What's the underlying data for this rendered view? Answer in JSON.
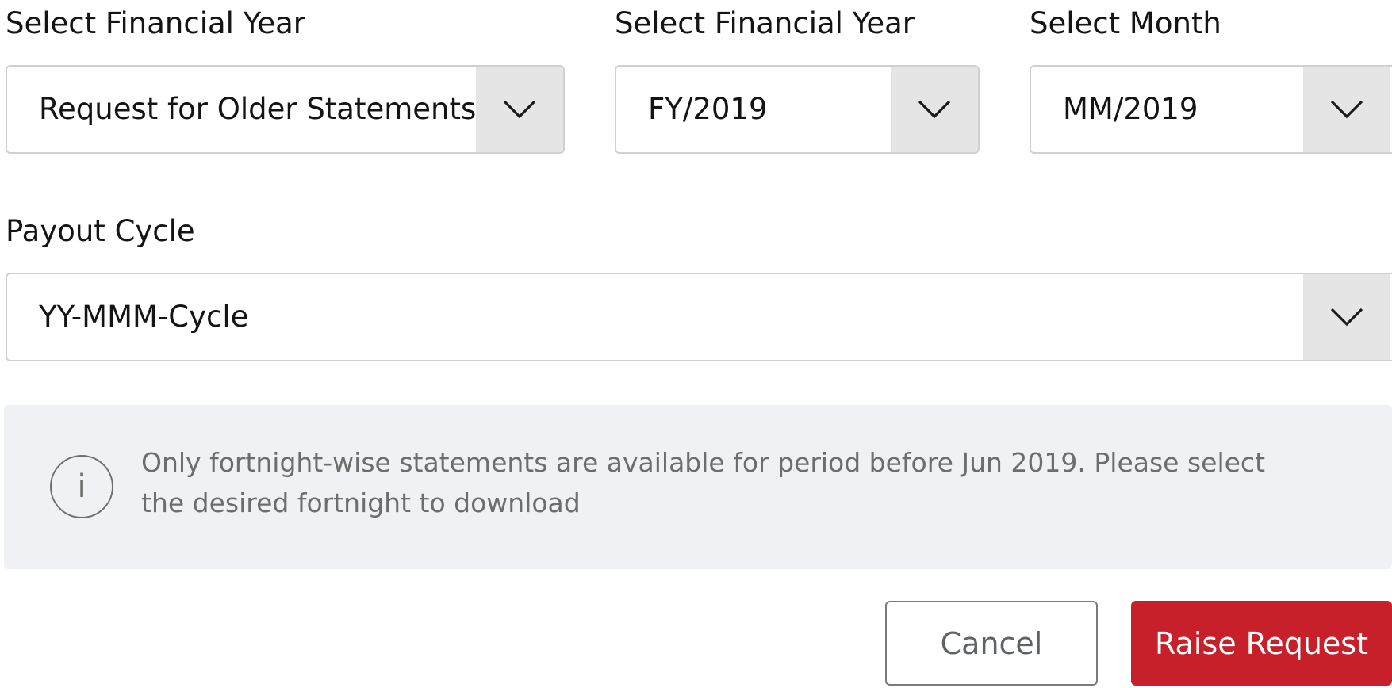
{
  "fields": {
    "statement_type": {
      "label": "Select Financial Year",
      "value": "Request for Older Statements"
    },
    "financial_year": {
      "label": "Select Financial Year",
      "value": "FY/2019"
    },
    "month": {
      "label": "Select Month",
      "value": "MM/2019"
    },
    "payout_cycle": {
      "label": "Payout Cycle",
      "value": "YY-MMM-Cycle"
    }
  },
  "info": {
    "icon": "info-icon",
    "icon_glyph": "i",
    "text": "Only fortnight-wise statements are available for period before Jun 2019. Please select the desired fortnight to download"
  },
  "actions": {
    "cancel_label": "Cancel",
    "raise_label": "Raise Request"
  },
  "colors": {
    "primary": "#c8202b",
    "info_background": "#f0f1f4",
    "dropdown_button": "#e5e5e5"
  }
}
